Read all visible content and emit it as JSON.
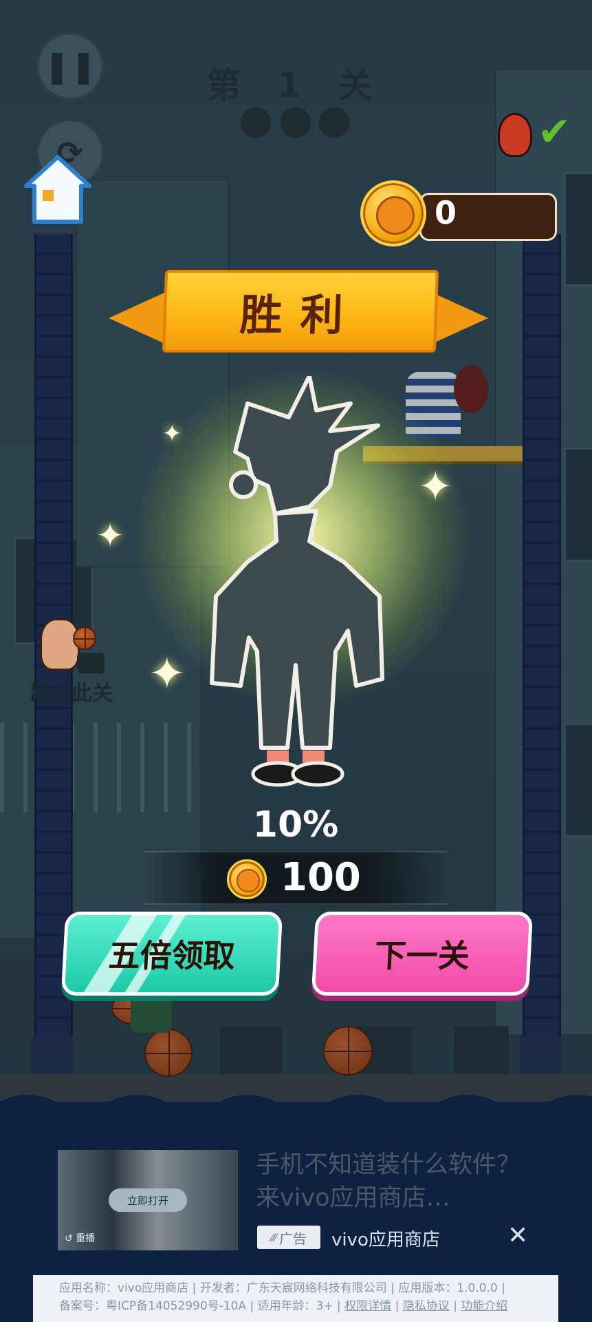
{
  "hud": {
    "level_title": "第 1 关",
    "coin_count": "0"
  },
  "result": {
    "banner": "胜利",
    "percent": "10%",
    "reward_amount": "100"
  },
  "buttons": {
    "double_reward": "五倍领取",
    "next_level": "下一关"
  },
  "side": {
    "skip_level": "跳过此关"
  },
  "ad": {
    "title": "手机不知道装什么软件？来vivo应用商店…",
    "open_button": "立即打开",
    "replay": "重播",
    "badge": "广告",
    "advertiser": "vivo应用商店",
    "info_line1": "应用名称：vivo应用商店 | 开发者：广东天宸网络科技有限公司 | 应用版本：1.0.0.0 |",
    "info_line2_prefix": "备案号：粤ICP备14052990号-10A | 适用年龄：3+ |",
    "link_permissions": "权限详情",
    "link_privacy": "隐私协议",
    "link_features": "功能介绍"
  },
  "colors": {
    "banner_orange": "#fbb513",
    "double_button_teal": "#1dc9a8",
    "next_button_pink": "#f04ba9",
    "ad_background": "#0c2240"
  }
}
